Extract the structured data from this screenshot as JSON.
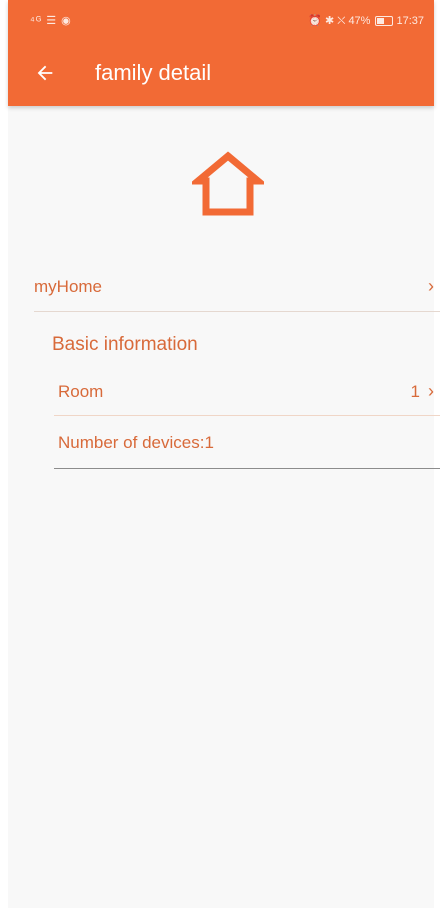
{
  "status_bar": {
    "left_icons": "⁴ᴳ ☰ ◉",
    "right_icons": "⏰ ✱ ⛌",
    "battery_percent": "47%",
    "time": "17:37"
  },
  "header": {
    "title": "family detail",
    "back_icon": "arrow-left-icon"
  },
  "home_icon": "house-icon",
  "family": {
    "name": "myHome"
  },
  "basic_info": {
    "title": "Basic information",
    "room_label": "Room",
    "room_count": "1",
    "devices_text": "Number of devices:1"
  },
  "colors": {
    "accent": "#f26a35",
    "text_accent": "#d86a3a",
    "background": "#f8f8f8"
  }
}
